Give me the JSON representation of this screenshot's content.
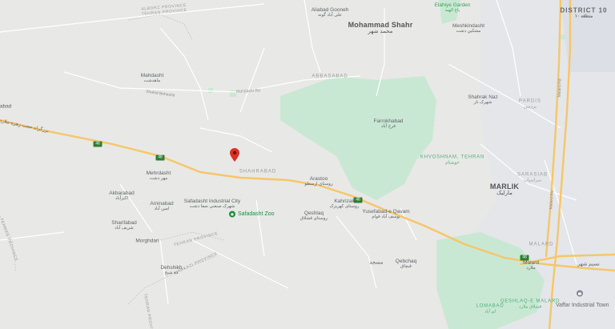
{
  "map": {
    "colors": {
      "land": "#e8e8e6",
      "green": "#c9e8d3",
      "highway": "#f6c667",
      "road": "#ffffff",
      "urban": "#dfe3ea",
      "pin": "#d93025",
      "poi_green": "#1e8e3e"
    },
    "districts": {
      "district10": "DISTRICT 10",
      "district10_fa": "منطقه ۱۰"
    },
    "towns": {
      "mohammad_shahr": "Mohammad Shahr",
      "mohammad_shahr_fa": "محمد شهر",
      "marlik": "MARLIK",
      "marlik_fa": "مارلیک",
      "aliabad_gooneh": "Aliabad Gooneh",
      "aliabad_gooneh_fa": "علی آباد گونه",
      "meshkindasht": "Meshkindasht",
      "meshkindasht_fa": "مشکین دشت",
      "mahdasht": "Mahdasht",
      "mahdasht_fa": "ماهدشت",
      "farrokhabad": "Farrokhabad",
      "farrokhabad_fa": "فرخ آباد",
      "shahrak_naz": "Shahrak Naz",
      "shahrak_naz_fa": "شهرک ناز",
      "mehrdasht": "Mehrdasht",
      "mehrdasht_fa": "مهر دشت",
      "akbarabad": "Akbarabad",
      "akbarabad_fa": "اکبرآباد",
      "aminabad": "Aminabad",
      "aminabad_fa": "امین آباد",
      "sharifabad": "Sharifabad",
      "sharifabad_fa": "شریف آباد",
      "morghdari": "Morghdari",
      "dehshikh": "Dehshikh",
      "dehshikh_fa": "ده شیخ",
      "arastoo": "Arastoo",
      "arastoo_fa": "روستای ارسطو",
      "kahrizak": "Kahrizak",
      "kahrizak_fa": "روستای کهریزک",
      "yusefabad": "Yusefabad-e Qavam",
      "yusefabad_fa": "یوسف آباد قوام",
      "qeshlaq": "Qeshlaq",
      "qeshlaq_fa": "روستای قشلاق",
      "qebchaq": "Qebchaq",
      "qebchaq_fa": "قبچاق",
      "malard": "Malard",
      "malard_fa": "ملارد",
      "safadasht_ind": "Safadasht Industrial City",
      "safadasht_ind_fa": "شهرک صنعتی صفا دشت",
      "nasimshahr_fa": "نسیم شهر",
      "sample_fa": "مسجد"
    },
    "areas": {
      "abbasabad": "ABBASABAD",
      "shahrabad": "SHAHRABAD",
      "shahrabad_fa": "شهرآباد",
      "pardis": "PARDIS",
      "pardis_fa": "پردیس",
      "sarasiab": "SARASIAB",
      "sarasiab_fa": "سراسیاب",
      "malard_area": "MALARD",
      "khvoshnam": "KHVOSHNAM, TEHRAN",
      "khvoshnam_fa": "خوشنام",
      "lomabad": "LOMABAD",
      "lomabad_fa": "لم آباد",
      "qeshlaq_malard": "QESHLAQ-E MALARD",
      "qeshlaq_malard_fa": "قشلاق ملارد",
      "province_top": "ALBORZ PROVINCE",
      "province_top2": "TEHRAN PROVINCE",
      "province_left": "TEHRAN PROVINCE",
      "province_mid": "TEHRAN PROVINCE",
      "province_bottom": "MARKAZI PROVINCE",
      "province_bottom2": "TEHRAN PROVINCE"
    },
    "pois": {
      "safadasht_zoo": "Safadasht Zoo",
      "vaffar_industrial_town": "Vaffar Industrial Town",
      "elahiye_garden": "Elahiye Garden",
      "elahiye_garden_fa": "باغ الهیه"
    },
    "roads": {
      "highway_label": "بزرگراه حجت زهره-ملارد",
      "shield_1": "48",
      "shield_2": "48",
      "shield_3": "48",
      "shield_4": "48",
      "malard_rd": "Malard Rd",
      "road_small_1": "Mahdasht Rd",
      "road_small_2": "Shahid Beheshti"
    },
    "left_edge": "rabad"
  }
}
